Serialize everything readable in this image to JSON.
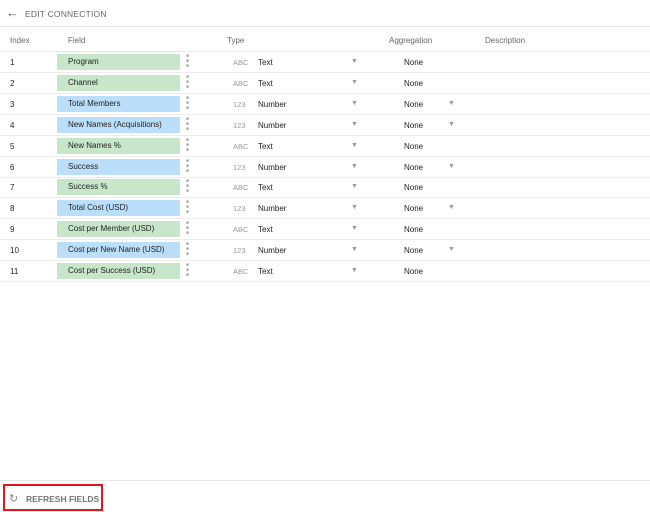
{
  "header": {
    "title": "EDIT CONNECTION",
    "back_icon": "arrow-left-icon"
  },
  "columns": {
    "index": "Index",
    "field": "Field",
    "type": "Type",
    "aggregation": "Aggregation",
    "description": "Description"
  },
  "colors": {
    "dimension": "#c8e6c9",
    "metric": "#bbdefb",
    "highlight": "#e3141d"
  },
  "rows": [
    {
      "index": "1",
      "field": "Program",
      "kind": "dimension",
      "type_icon": "ABC",
      "type": "Text",
      "aggregation": "None"
    },
    {
      "index": "2",
      "field": "Channel",
      "kind": "dimension",
      "type_icon": "ABC",
      "type": "Text",
      "aggregation": "None"
    },
    {
      "index": "3",
      "field": "Total Members",
      "kind": "metric",
      "type_icon": "123",
      "type": "Number",
      "aggregation": "None"
    },
    {
      "index": "4",
      "field": "New Names (Acquisitions)",
      "kind": "metric",
      "type_icon": "123",
      "type": "Number",
      "aggregation": "None"
    },
    {
      "index": "5",
      "field": "New Names %",
      "kind": "dimension",
      "type_icon": "ABC",
      "type": "Text",
      "aggregation": "None"
    },
    {
      "index": "6",
      "field": "Success",
      "kind": "metric",
      "type_icon": "123",
      "type": "Number",
      "aggregation": "None"
    },
    {
      "index": "7",
      "field": "Success %",
      "kind": "dimension",
      "type_icon": "ABC",
      "type": "Text",
      "aggregation": "None"
    },
    {
      "index": "8",
      "field": "Total Cost (USD)",
      "kind": "metric",
      "type_icon": "123",
      "type": "Number",
      "aggregation": "None"
    },
    {
      "index": "9",
      "field": "Cost per Member (USD)",
      "kind": "dimension",
      "type_icon": "ABC",
      "type": "Text",
      "aggregation": "None"
    },
    {
      "index": "10",
      "field": "Cost per New Name (USD)",
      "kind": "metric",
      "type_icon": "123",
      "type": "Number",
      "aggregation": "None"
    },
    {
      "index": "11",
      "field": "Cost per Success (USD)",
      "kind": "dimension",
      "type_icon": "ABC",
      "type": "Text",
      "aggregation": "None"
    }
  ],
  "footer": {
    "refresh_label": "REFRESH FIELDS",
    "refresh_icon": "refresh-icon"
  }
}
